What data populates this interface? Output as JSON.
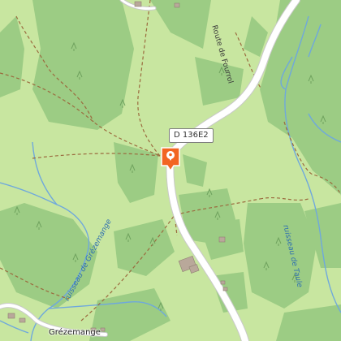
{
  "map": {
    "road_shield": "D 136E2",
    "road_name": "Route de Fourrol",
    "stream_left": "ruisseau de Grézemange",
    "stream_right": "ruisseau de Taule",
    "place": "Grézemange",
    "marker": {
      "icon": "location-pin-icon",
      "color": "#f26522"
    },
    "colors": {
      "meadow": "#c8e6a0",
      "forest": "#9ccc84",
      "road": "#ffffff",
      "water": "#6fa8dc",
      "path": "#9b6b3f"
    }
  }
}
